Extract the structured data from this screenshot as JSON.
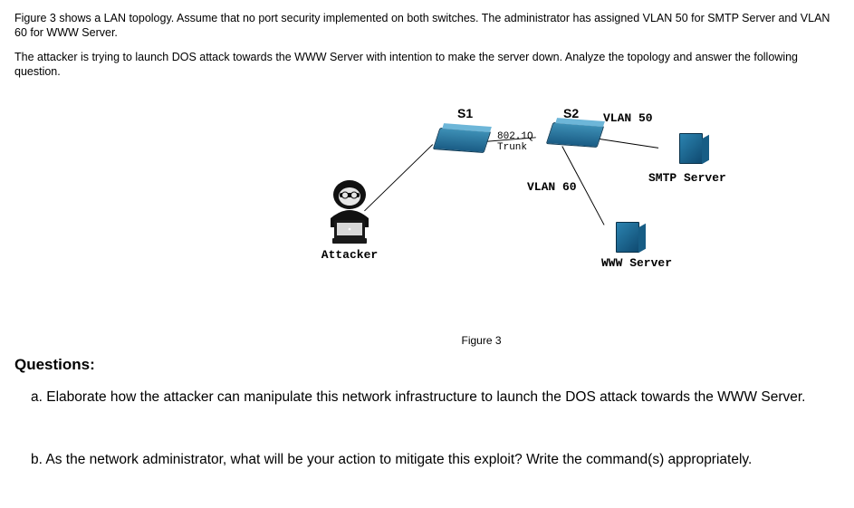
{
  "intro": {
    "line1": "Figure 3 shows a LAN topology. Assume that no port security implemented on both switches. The administrator has assigned VLAN 50 for SMTP Server and VLAN 60 for WWW Server.",
    "line2": "The attacker is trying to launch DOS attack towards the WWW Server with intention to make the server down. Analyze the topology and answer the following question."
  },
  "topology": {
    "switch1_label": "S1",
    "switch2_label": "S2",
    "trunk_label_1": "802.1Q",
    "trunk_label_2": "Trunk",
    "vlan50_label": "VLAN 50",
    "vlan60_label": "VLAN 60",
    "smtp_label": "SMTP Server",
    "www_label": "WWW Server",
    "attacker_label": "Attacker"
  },
  "figure_caption": "Figure 3",
  "questions_heading": "Questions:",
  "question_a": "a. Elaborate how the attacker can manipulate this network infrastructure to launch the DOS attack towards the WWW Server.",
  "question_b": "b. As the network administrator, what will be your action to mitigate this exploit? Write the command(s) appropriately."
}
